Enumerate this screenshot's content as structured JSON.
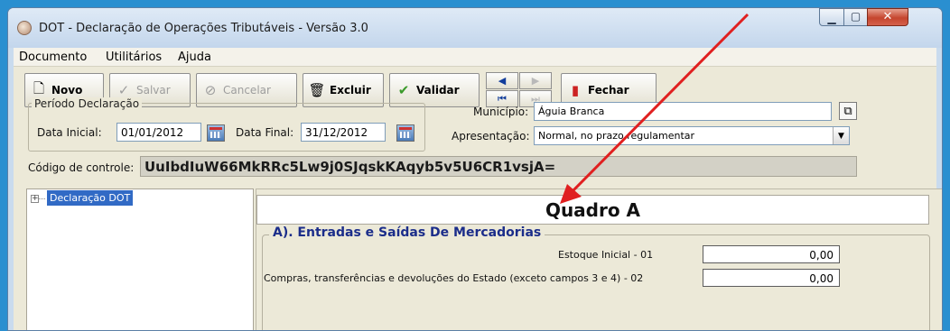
{
  "window": {
    "title": "DOT - Declaração de Operações Tributáveis  - Versão 3.0"
  },
  "menu": {
    "items": [
      "Documento",
      "Utilitários",
      "Ajuda"
    ]
  },
  "toolbar": {
    "novo": "Novo",
    "salvar": "Salvar",
    "cancelar": "Cancelar",
    "excluir": "Excluir",
    "validar": "Validar",
    "fechar": "Fechar"
  },
  "periodo": {
    "legend": "Período Declaração",
    "data_inicial_label": "Data Inicial:",
    "data_inicial": "01/01/2012",
    "data_final_label": "Data Final:",
    "data_final": "31/12/2012"
  },
  "municipio": {
    "label": "Município:",
    "value": "Águia Branca"
  },
  "apresentacao": {
    "label": "Apresentação:",
    "value": "Normal, no prazo regulamentar"
  },
  "controle": {
    "label": "Código de controle:",
    "value": "UuIbdIuW66MkRRc5Lw9j0SJqskKAqyb5v5U6CR1vsjA="
  },
  "tree": {
    "root": "Declaração DOT",
    "toggle": "+"
  },
  "quadro": {
    "title": "Quadro A",
    "section": "A). Entradas e Saídas De Mercadorias",
    "rows": [
      {
        "label": "Estoque Inicial - 01",
        "value": "0,00"
      },
      {
        "label": "Compras, transferências e devoluções do Estado (exceto campos 3 e 4) - 02",
        "value": "0,00"
      }
    ]
  },
  "colors": {
    "desktop": "#2a8fd0",
    "annotation_arrow": "#e02020",
    "tree_selection": "#316ac5"
  }
}
